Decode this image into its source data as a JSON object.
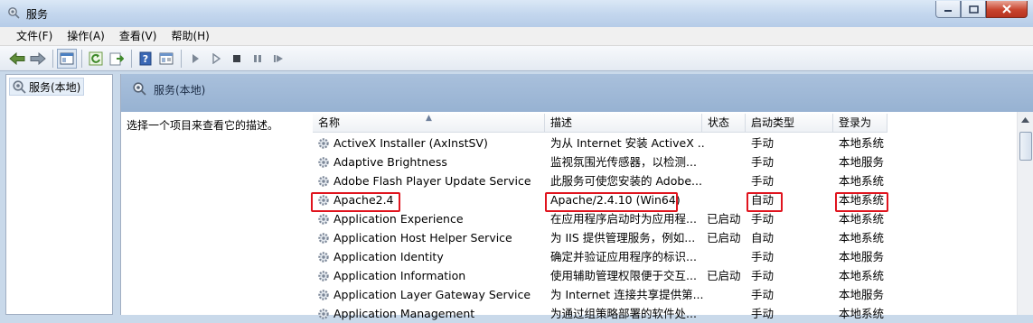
{
  "window": {
    "title": "服务"
  },
  "menu": [
    "文件(F)",
    "操作(A)",
    "查看(V)",
    "帮助(H)"
  ],
  "tree": {
    "item_label": "服务(本地)"
  },
  "pane": {
    "header_title": "服务(本地)",
    "description_hint": "选择一个项目来查看它的描述。"
  },
  "columns": {
    "name": "名称",
    "description": "描述",
    "status": "状态",
    "startup": "启动类型",
    "logon": "登录为"
  },
  "services": [
    {
      "name": "ActiveX Installer (AxInstSV)",
      "description": "为从 Internet 安装 ActiveX ...",
      "status": "",
      "startup": "手动",
      "logon": "本地系统"
    },
    {
      "name": "Adaptive Brightness",
      "description": "监视氛围光传感器，以检测...",
      "status": "",
      "startup": "手动",
      "logon": "本地服务"
    },
    {
      "name": "Adobe Flash Player Update Service",
      "description": "此服务可使您安装的 Adobe...",
      "status": "",
      "startup": "手动",
      "logon": "本地系统"
    },
    {
      "name": "Apache2.4",
      "description": "Apache/2.4.10 (Win64)",
      "status": "",
      "startup": "自动",
      "logon": "本地系统"
    },
    {
      "name": "Application Experience",
      "description": "在应用程序启动时为应用程...",
      "status": "已启动",
      "startup": "手动",
      "logon": "本地系统"
    },
    {
      "name": "Application Host Helper Service",
      "description": "为 IIS 提供管理服务，例如...",
      "status": "已启动",
      "startup": "自动",
      "logon": "本地系统"
    },
    {
      "name": "Application Identity",
      "description": "确定并验证应用程序的标识...",
      "status": "",
      "startup": "手动",
      "logon": "本地服务"
    },
    {
      "name": "Application Information",
      "description": "使用辅助管理权限便于交互...",
      "status": "已启动",
      "startup": "手动",
      "logon": "本地系统"
    },
    {
      "name": "Application Layer Gateway Service",
      "description": "为 Internet 连接共享提供第...",
      "status": "",
      "startup": "手动",
      "logon": "本地服务"
    },
    {
      "name": "Application Management",
      "description": "为通过组策略部署的软件处...",
      "status": "",
      "startup": "手动",
      "logon": "本地系统"
    }
  ],
  "highlighted_service": "Apache2.4",
  "colors": {
    "highlight": "#e0141e",
    "pane_header": "#a9c0dc"
  }
}
